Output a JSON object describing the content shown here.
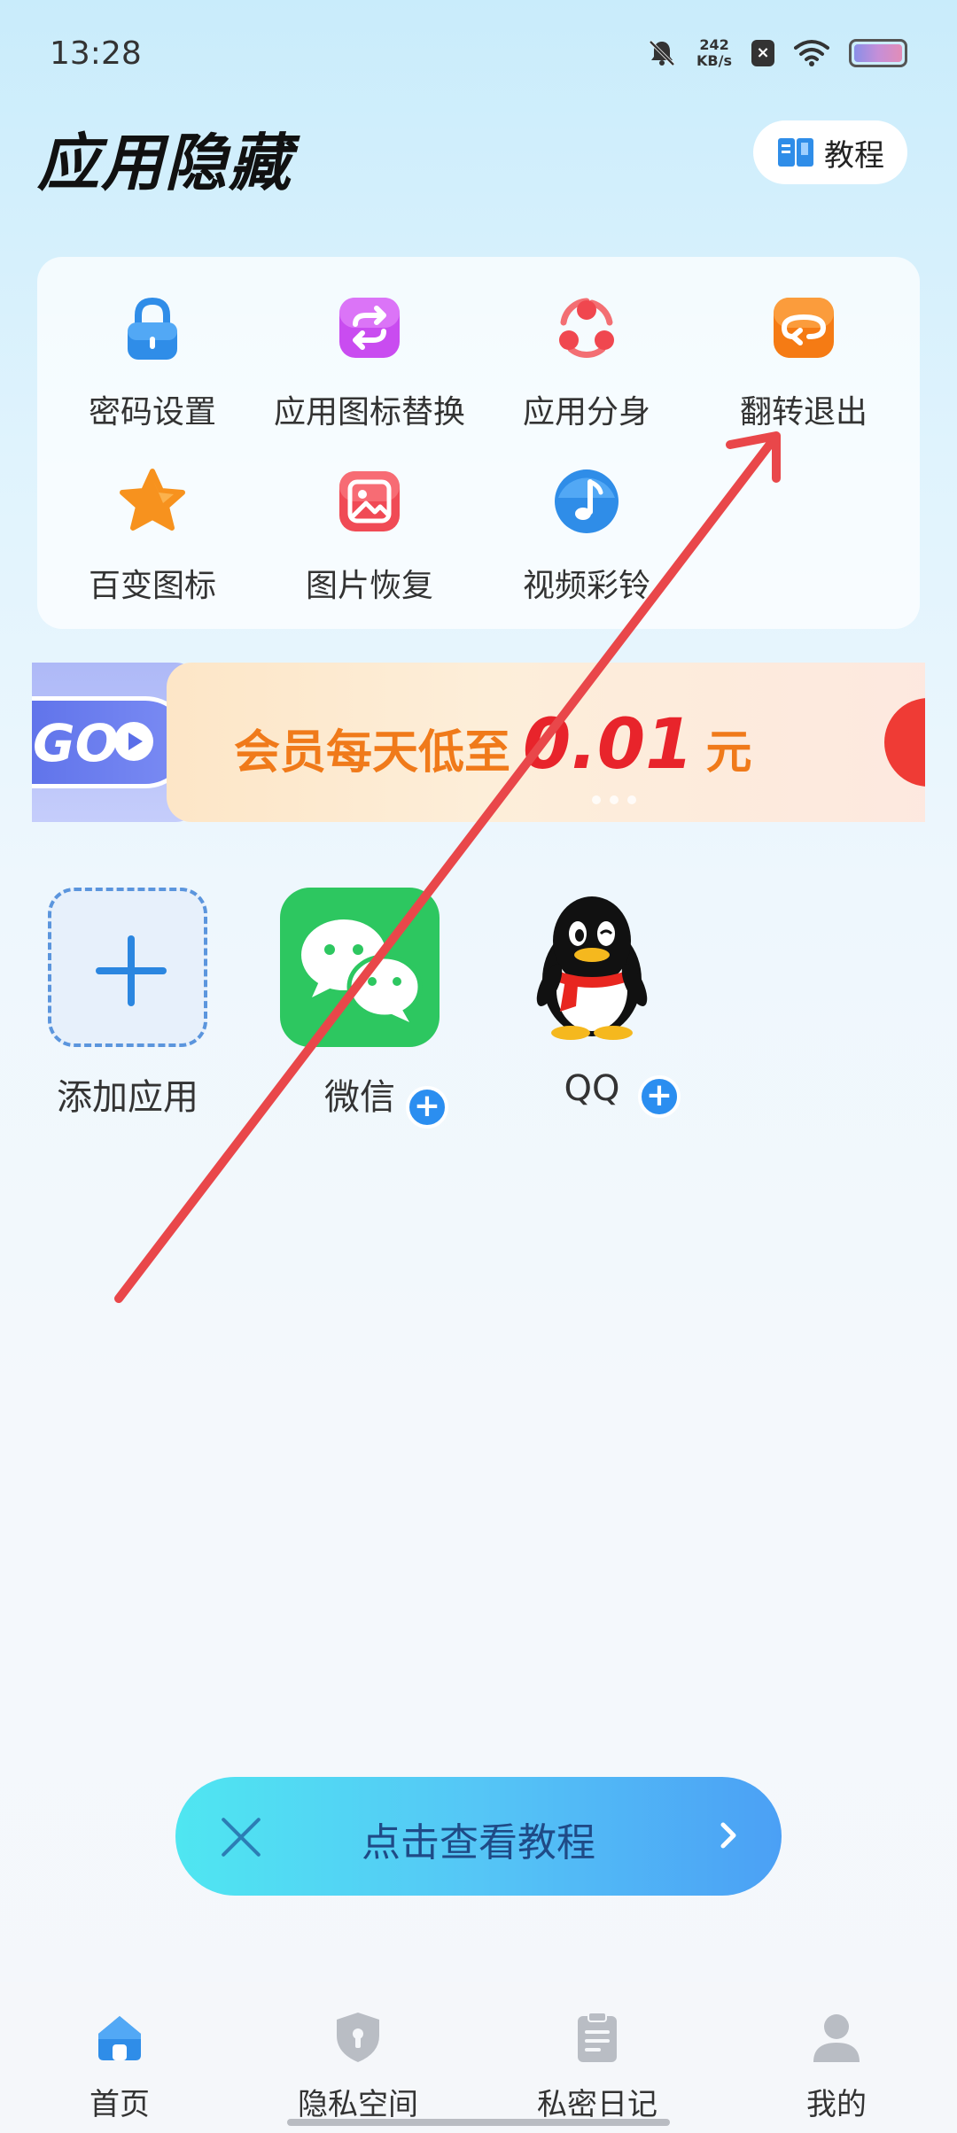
{
  "status_bar": {
    "time": "13:28",
    "net_speed_value": "242",
    "net_speed_unit": "KB/s",
    "icons": [
      "mute-icon",
      "close-box-icon",
      "wifi-icon",
      "battery-icon"
    ]
  },
  "header": {
    "title": "应用隐藏",
    "tutorial_label": "教程"
  },
  "tools": [
    {
      "label": "密码设置",
      "icon": "lock-icon",
      "color": "#2f8de8"
    },
    {
      "label": "应用图标替换",
      "icon": "swap-icon",
      "color": "#c94cf0"
    },
    {
      "label": "应用分身",
      "icon": "clone-icon",
      "color": "#f0474f"
    },
    {
      "label": "翻转退出",
      "icon": "flip-icon",
      "color": "#f57b14"
    },
    {
      "label": "百变图标",
      "icon": "star-icon",
      "color": "#f7921e"
    },
    {
      "label": "图片恢复",
      "icon": "image-icon",
      "color": "#f04a55"
    },
    {
      "label": "视频彩铃",
      "icon": "music-icon",
      "color": "#2f8de8"
    }
  ],
  "banner": {
    "prev_text": "GO",
    "prefix": "会员每天低至",
    "price": "0.01",
    "unit": "元"
  },
  "apps": [
    {
      "name": "添加应用",
      "icon": "add-icon"
    },
    {
      "name": "微信",
      "icon": "wechat-icon"
    },
    {
      "name": "QQ",
      "icon": "qq-icon"
    }
  ],
  "floating_bar": {
    "label": "点击查看教程"
  },
  "bottom_nav": [
    {
      "label": "首页",
      "icon": "home-icon",
      "active": true
    },
    {
      "label": "隐私空间",
      "icon": "shield-icon",
      "active": false
    },
    {
      "label": "私密日记",
      "icon": "clipboard-icon",
      "active": false
    },
    {
      "label": "我的",
      "icon": "user-icon",
      "active": false
    }
  ],
  "colors": {
    "accent": "#2f8de8",
    "annotation_arrow": "#e9474a",
    "price_red": "#e8242b",
    "banner_orange": "#f07a1a"
  }
}
